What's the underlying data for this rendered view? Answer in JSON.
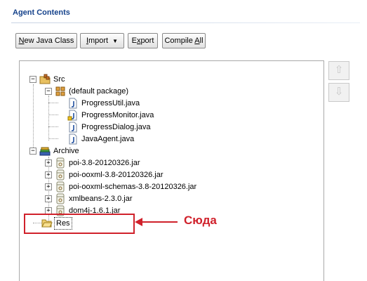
{
  "section": {
    "title": "Agent Contents"
  },
  "toolbar": {
    "new_java_class": {
      "mnemonic": "N",
      "rest": "ew Java Class"
    },
    "import": {
      "mnemonic": "I",
      "rest": "mport"
    },
    "export": {
      "pre": "E",
      "mnemonic": "x",
      "rest": "port"
    },
    "compile_all": {
      "pre": "Compile ",
      "mnemonic": "A",
      "rest": "ll"
    }
  },
  "side_buttons": {
    "move_up": "⇧",
    "move_down": "⇩"
  },
  "tree": {
    "src": {
      "label": "Src",
      "default_package": {
        "label": "(default package)",
        "files": [
          "ProgressUtil.java",
          "ProgressMonitor.java",
          "ProgressDialog.java",
          "JavaAgent.java"
        ]
      }
    },
    "archive": {
      "label": "Archive",
      "jars": [
        "poi-3.8-20120326.jar",
        "poi-ooxml-3.8-20120326.jar",
        "poi-ooxml-schemas-3.8-20120326.jar",
        "xmlbeans-2.3.0.jar",
        "dom4j-1.6.1.jar"
      ]
    },
    "res": {
      "label": "Res"
    }
  },
  "annotation": {
    "text": "Сюда",
    "color": "#d0212b"
  }
}
